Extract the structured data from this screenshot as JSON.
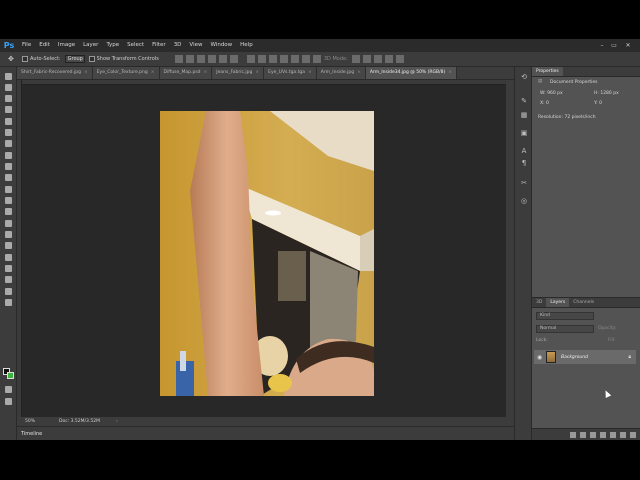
{
  "app": {
    "logo": "Ps"
  },
  "menu": [
    "File",
    "Edit",
    "Image",
    "Layer",
    "Type",
    "Select",
    "Filter",
    "3D",
    "View",
    "Window",
    "Help"
  ],
  "window_controls": [
    "–",
    "▭",
    "✕"
  ],
  "options": {
    "auto_select_label": "Auto-Select:",
    "auto_select_value": "Group",
    "transform_label": "Show Transform Controls",
    "mode_label": "3D Mode:"
  },
  "doc_tabs": [
    "Shirt_Fabric-Recovered.jpg",
    "Eye_Color_Texture.png",
    "Diffuse_Map.psd",
    "Jeans_Fabric.jpg",
    "Eye_UVs.tga.tga",
    "Arm_Inside.jpg",
    "Arm_Inside34.jpg @ 50% (RGB/8)"
  ],
  "status": {
    "zoom": "50%",
    "doc": "Doc: 3.52M/3.52M"
  },
  "timeline": {
    "label": "Timeline"
  },
  "properties": {
    "tabs": [
      "Properties"
    ],
    "title": "Document Properties",
    "w": "W: 960 px",
    "h": "H: 1280 px",
    "x": "X: 0",
    "y": "Y: 0",
    "resolution": "Resolution: 72 pixels/inch"
  },
  "layers": {
    "tabs": [
      "3D",
      "Layers",
      "Channels"
    ],
    "kind_label": "Kind",
    "blend_mode": "Normal",
    "opacity_label": "Opacity:",
    "lock_label": "Lock:",
    "fill_label": "Fill:",
    "layer_name": "Background"
  },
  "colors": {
    "foreground": "#111111",
    "background": "#3cb43c",
    "accent": "#3aa0f5"
  }
}
